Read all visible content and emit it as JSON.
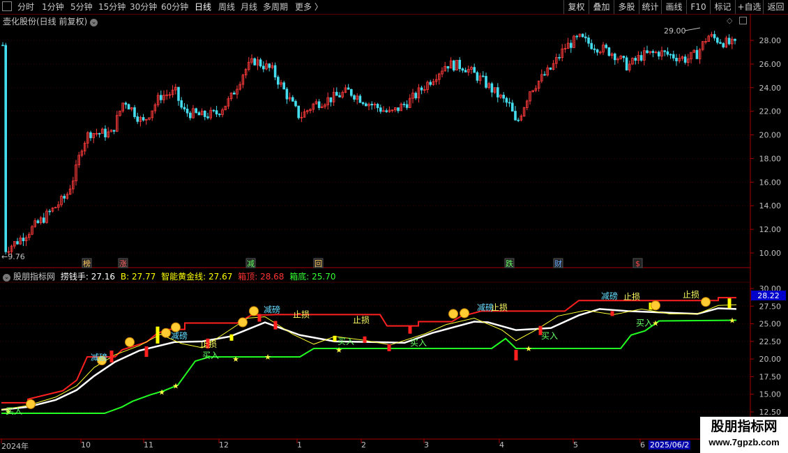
{
  "toolbar": {
    "periods": [
      "分时",
      "1分钟",
      "5分钟",
      "15分钟",
      "30分钟",
      "60分钟",
      "日线",
      "周线",
      "月线",
      "多周期",
      "更多 〉"
    ],
    "active": "日线",
    "buttons": [
      "复权",
      "叠加",
      "多股",
      "统计",
      "画线",
      "F10",
      "标记",
      "+自选",
      "返回"
    ]
  },
  "main": {
    "title": "壶化股份(日线 前复权)",
    "high_marker": "29.00",
    "low_marker": "9.76",
    "y_ticks": [
      "28.00",
      "26.00",
      "24.00",
      "22.00",
      "20.00",
      "18.00",
      "16.00",
      "14.00",
      "12.00",
      "10.00"
    ],
    "event_tags": [
      {
        "text": "榜",
        "color": "#ffcc66"
      },
      {
        "text": "涨",
        "color": "#ff6666"
      },
      {
        "text": "减",
        "color": "#66ff66"
      },
      {
        "text": "回",
        "color": "#ffcc66"
      },
      {
        "text": "跌",
        "color": "#66ff66"
      },
      {
        "text": "财",
        "color": "#66aaff"
      },
      {
        "text": "$",
        "color": "#ff4444"
      }
    ]
  },
  "indicator": {
    "name": "股朋指标网",
    "fields": [
      {
        "label": "捞钱手: 27.16",
        "color": "#ffffff"
      },
      {
        "label": "B: 27.77",
        "color": "#ffff00"
      },
      {
        "label": "智能黄金线: 27.67",
        "color": "#ffff00"
      },
      {
        "label": "箱顶: 28.68",
        "color": "#ff3333"
      },
      {
        "label": "箱底: 25.70",
        "color": "#33ff33"
      }
    ],
    "y_ticks": [
      "30.00",
      "27.50",
      "25.00",
      "22.50",
      "20.00",
      "17.50",
      "15.00",
      "12.50"
    ],
    "current_value": "28.22",
    "annotations": [
      {
        "text": "减磅",
        "color": "#66ddff"
      },
      {
        "text": "减磅",
        "color": "#66ddff"
      },
      {
        "text": "止损",
        "color": "#ffff66"
      },
      {
        "text": "减磅",
        "color": "#66ddff"
      },
      {
        "text": "止损",
        "color": "#ffff66"
      },
      {
        "text": "止损",
        "color": "#ffff66"
      },
      {
        "text": "减磅",
        "color": "#66ddff"
      },
      {
        "text": "止损",
        "color": "#ffff66"
      },
      {
        "text": "减磅",
        "color": "#66ddff"
      },
      {
        "text": "止损",
        "color": "#ffff66"
      },
      {
        "text": "止损",
        "color": "#ffff66"
      },
      {
        "text": "买入",
        "color": "#66ff66"
      },
      {
        "text": "买入",
        "color": "#66ff66"
      },
      {
        "text": "买入",
        "color": "#66ff66"
      },
      {
        "text": "买入",
        "color": "#66ff66"
      },
      {
        "text": "买入",
        "color": "#66ff66"
      },
      {
        "text": "买入",
        "color": "#66ff66"
      }
    ]
  },
  "x_axis": [
    "2024年",
    "10",
    "11",
    "12",
    "1",
    "2",
    "3",
    "4",
    "5",
    "6",
    "2025/06/2"
  ],
  "watermark": {
    "title": "股朋指标网",
    "url": "www.7gpzb.com"
  }
}
